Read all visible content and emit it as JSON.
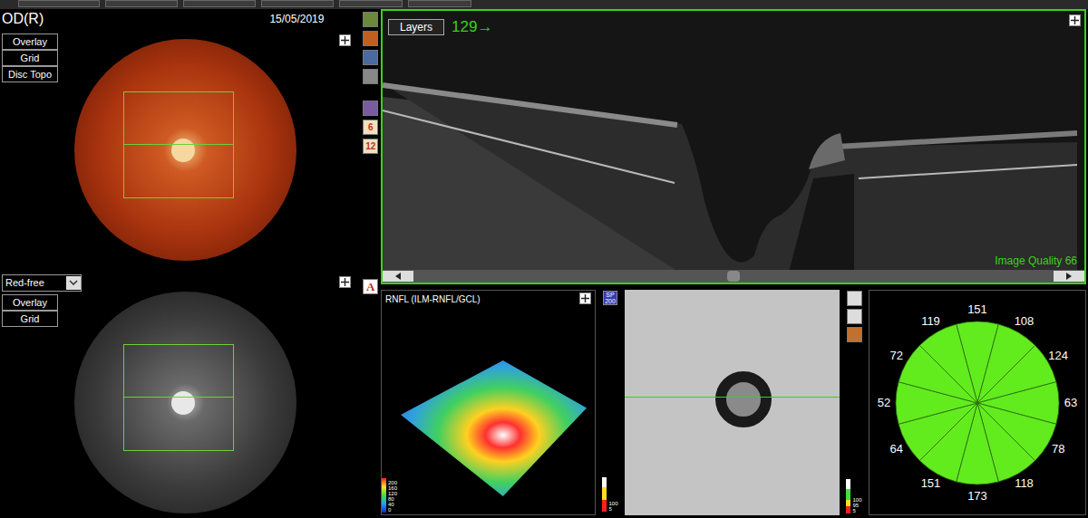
{
  "header": {
    "eye": "OD(R)",
    "date": "15/05/2019"
  },
  "color_photo": {
    "buttons": [
      "Overlay",
      "Grid",
      "Disc Topo"
    ]
  },
  "red_free": {
    "select": "Red-free",
    "buttons": [
      "Overlay",
      "Grid"
    ]
  },
  "tool_labels": [
    "6",
    "12",
    "A"
  ],
  "bscan": {
    "button": "Layers",
    "slice": "129→",
    "quality": "Image Quality 66"
  },
  "rnfl_map": {
    "title": "RNFL (ILM-RNFL/GCL)",
    "scale": [
      "200",
      "160",
      "120",
      "80",
      "40",
      "0"
    ]
  },
  "enface": {
    "badge": [
      "SP",
      "200"
    ],
    "scale": [
      "100",
      "5"
    ]
  },
  "clock": {
    "scale": [
      "100",
      "95",
      "5"
    ],
    "sectors": [
      {
        "label": "151",
        "color": "#62ec1e"
      },
      {
        "label": "108",
        "color": "#62ec1e"
      },
      {
        "label": "124",
        "color": "#62ec1e"
      },
      {
        "label": "63",
        "color": "#62ec1e"
      },
      {
        "label": "78",
        "color": "#62ec1e"
      },
      {
        "label": "118",
        "color": "#62ec1e"
      },
      {
        "label": "173",
        "color": "#62ec1e"
      },
      {
        "label": "151",
        "color": "#62ec1e"
      },
      {
        "label": "64",
        "color": "#62ec1e"
      },
      {
        "label": "52",
        "color": "#62ec1e"
      },
      {
        "label": "72",
        "color": "#62ec1e"
      },
      {
        "label": "119",
        "color": "#62ec1e"
      }
    ]
  }
}
